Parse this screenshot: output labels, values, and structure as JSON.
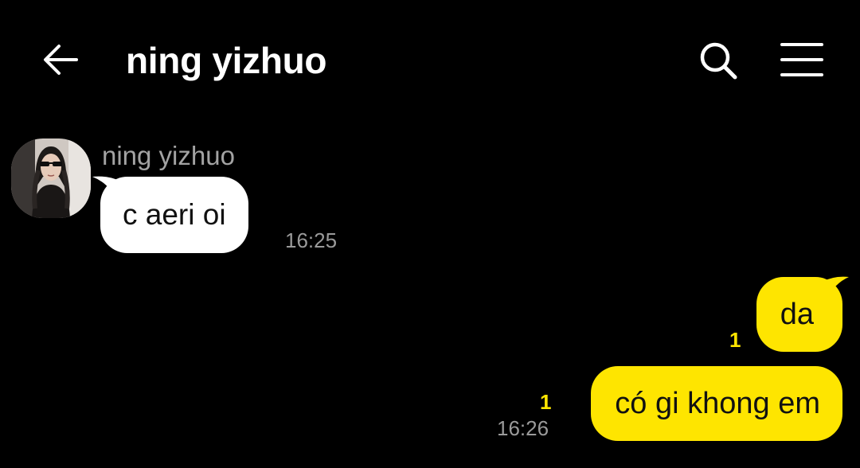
{
  "header": {
    "title": "ning yizhuo",
    "back_icon": "arrow-left-icon",
    "search_icon": "search-icon",
    "menu_icon": "hamburger-menu-icon"
  },
  "messages": {
    "incoming": {
      "sender": "ning yizhuo",
      "avatar": "avatar-photo",
      "text": "c aeri oi",
      "time": "16:25"
    },
    "outgoing": [
      {
        "text": "da",
        "unread": "1"
      },
      {
        "text": "có gi khong em",
        "unread": "1",
        "time": "16:26"
      }
    ]
  },
  "colors": {
    "background": "#000000",
    "outgoing_bubble": "#fee500",
    "incoming_bubble": "#ffffff",
    "timestamp": "#9a9a9a",
    "unread_count": "#fee500"
  }
}
